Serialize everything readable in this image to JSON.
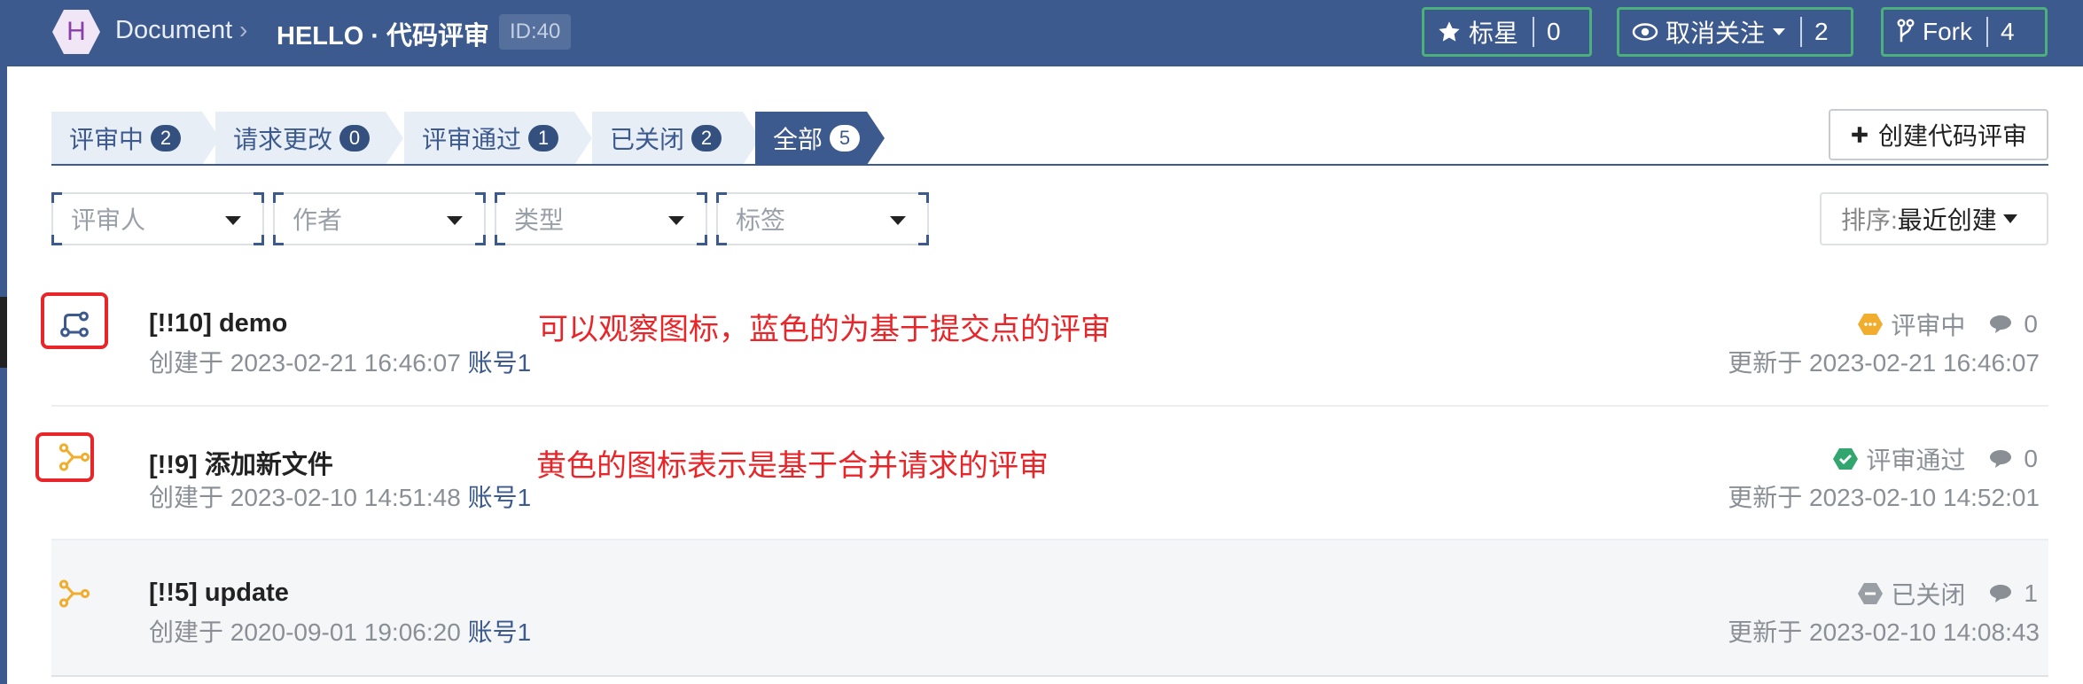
{
  "header": {
    "logo_letter": "H",
    "crumb_doc": "Document",
    "crumb_sep": "›",
    "repo_title": "HELLO · 代码评审",
    "id_badge": "ID:40",
    "star": {
      "label": "标星",
      "count": "0",
      "icon": "star-icon"
    },
    "watch": {
      "label": "取消关注",
      "count": "2",
      "icon": "eye-icon"
    },
    "fork": {
      "label": "Fork",
      "count": "4",
      "icon": "fork-icon"
    }
  },
  "tabs": [
    {
      "label": "评审中",
      "count": "2"
    },
    {
      "label": "请求更改",
      "count": "0"
    },
    {
      "label": "评审通过",
      "count": "1"
    },
    {
      "label": "已关闭",
      "count": "2"
    },
    {
      "label": "全部",
      "count": "5",
      "active": true
    }
  ],
  "create_button": "创建代码评审",
  "filters": {
    "reviewer": "评审人",
    "author": "作者",
    "type": "类型",
    "tag": "标签"
  },
  "sort": {
    "label": "排序:",
    "value": "最近创建"
  },
  "reviews": [
    {
      "title": "[!!10] demo",
      "created": "创建于 2023-02-21 16:46:07",
      "account": "账号1",
      "status": "评审中",
      "status_color": "#f0ad2e",
      "comments": "0",
      "updated": "更新于 2023-02-21 16:46:07",
      "icon": "commit-review-icon",
      "icon_color": "#3d5a8e"
    },
    {
      "title": "[!!9] 添加新文件",
      "created": "创建于 2023-02-10 14:51:48",
      "account": "账号1",
      "status": "评审通过",
      "status_color": "#33a56e",
      "comments": "0",
      "updated": "更新于 2023-02-10 14:52:01",
      "icon": "merge-review-icon",
      "icon_color": "#f0ad2e"
    },
    {
      "title": "[!!5] update",
      "created": "创建于 2020-09-01 19:06:20",
      "account": "账号1",
      "status": "已关闭",
      "status_color": "#9a9ea5",
      "comments": "1",
      "updated": "更新于 2023-02-10 14:08:43",
      "icon": "merge-review-icon",
      "icon_color": "#f0ad2e"
    }
  ],
  "annotations": {
    "blue_note": "可以观察图标，蓝色的为基于提交点的评审",
    "yellow_note": "黄色的图标表示是基于合并请求的评审"
  }
}
